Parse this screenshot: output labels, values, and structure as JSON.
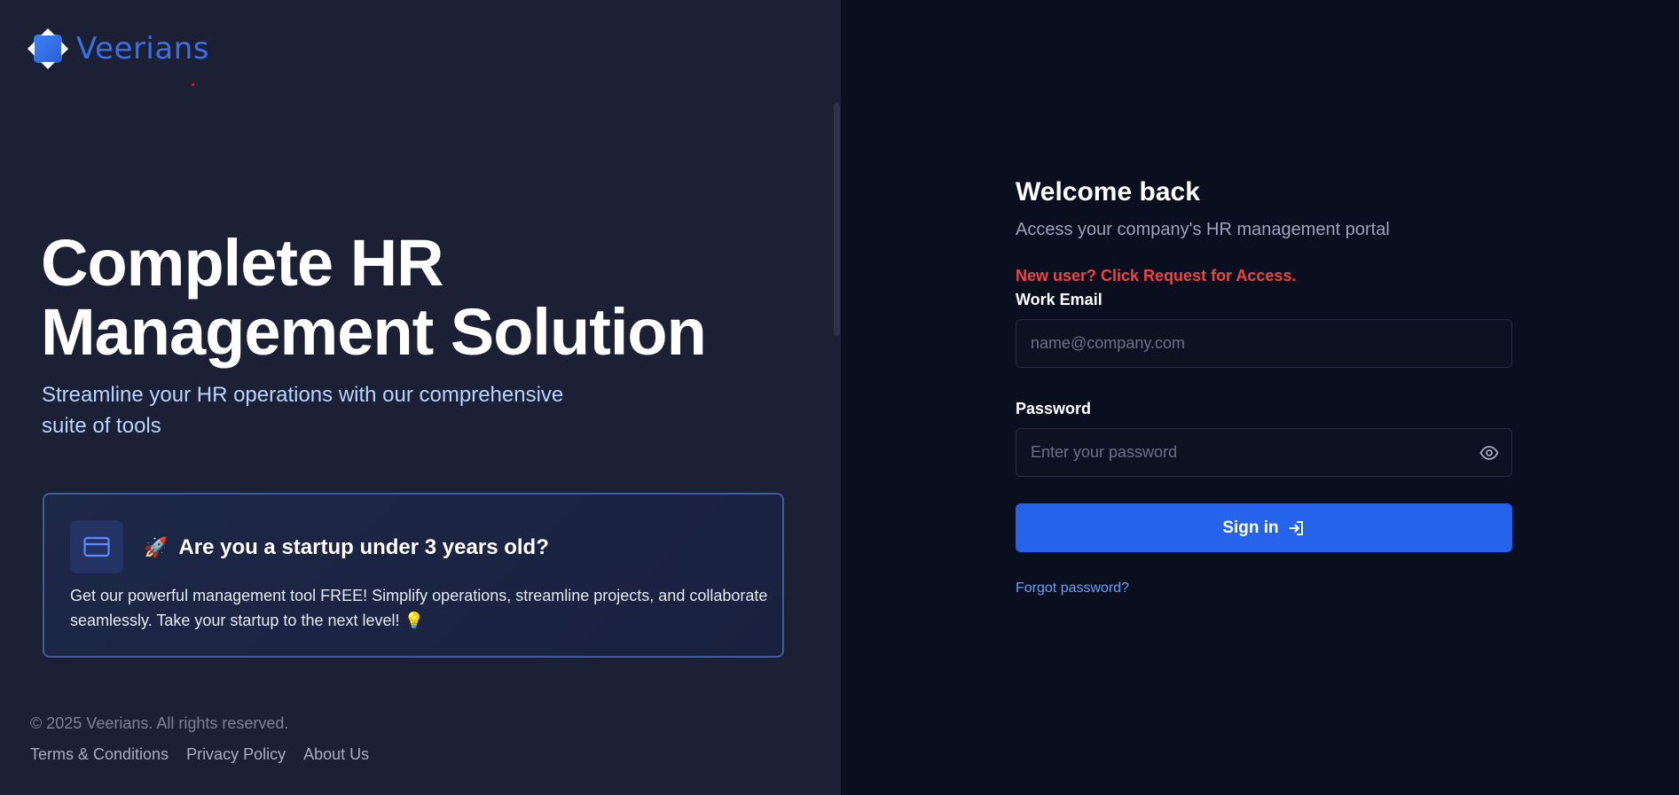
{
  "brand": {
    "name": "Veerians",
    "color": "#3b6fe8"
  },
  "hero": {
    "title_line1": "Complete HR",
    "title_line2": "Management Solution",
    "subtitle": "Streamline your HR operations with our comprehensive suite of tools"
  },
  "promo": {
    "icon": "credit-card-icon",
    "emoji": "🚀",
    "title": "Are you a startup under 3 years old?",
    "description": "Get our powerful management tool FREE! Simplify operations, streamline projects, and collaborate seamlessly. Take your startup to the next level! 💡"
  },
  "footer": {
    "copyright": "© 2025 Veerians. All rights reserved.",
    "links": [
      "Terms & Conditions",
      "Privacy Policy",
      "About Us"
    ]
  },
  "login": {
    "heading": "Welcome back",
    "subheading": "Access your company's HR management portal",
    "new_user_notice": "New user? Click Request for Access.",
    "email_label": "Work Email",
    "email_placeholder": "name@company.com",
    "email_value": "",
    "password_label": "Password",
    "password_placeholder": "Enter your password",
    "password_value": "",
    "signin_label": "Sign in",
    "forgot_label": "Forgot password?"
  },
  "colors": {
    "accent": "#2563eb",
    "error": "#ef4444",
    "link": "#60a5fa",
    "left_bg": "#1c2035",
    "right_bg": "#0a0f1f"
  }
}
